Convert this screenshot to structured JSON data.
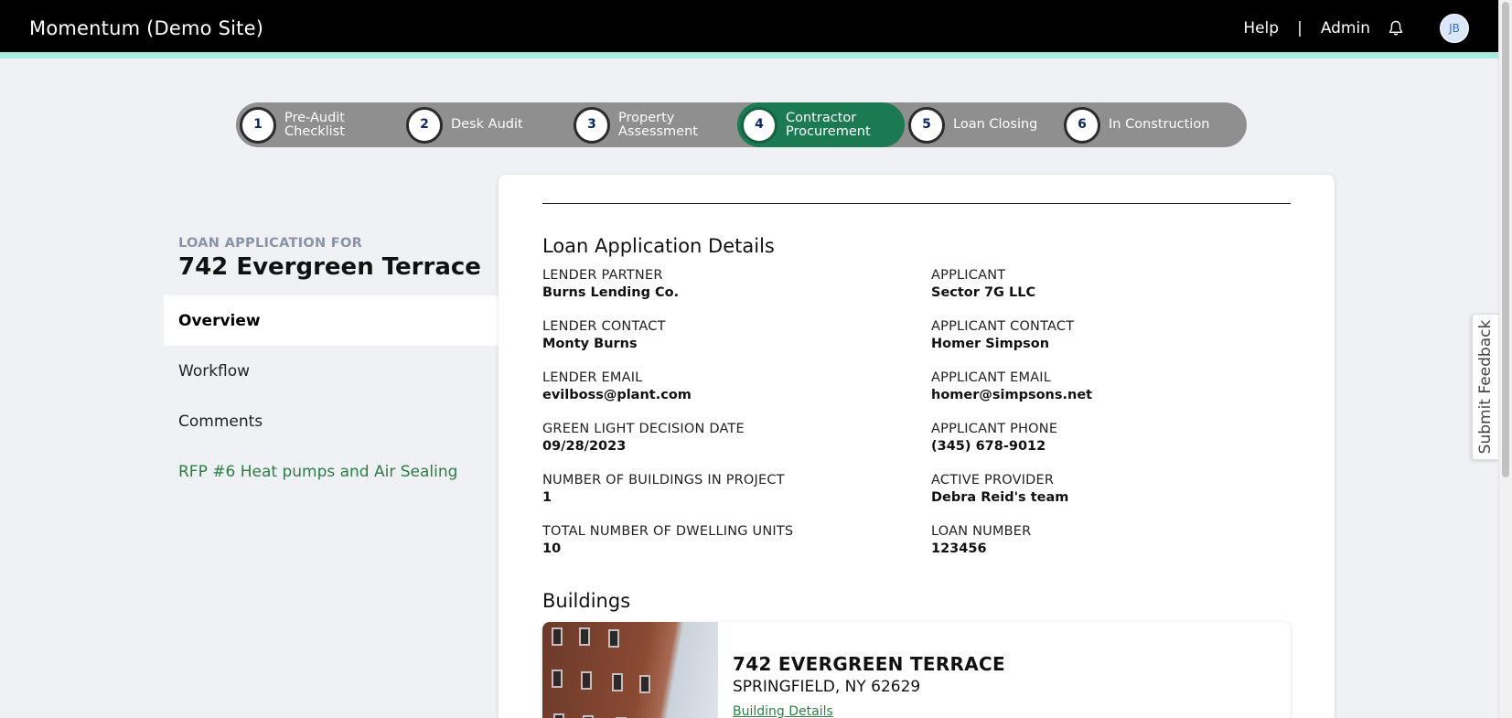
{
  "header": {
    "app_title": "Momentum (Demo Site)",
    "help": "Help",
    "separator": "|",
    "admin": "Admin",
    "avatar_initials": "JB"
  },
  "stepper": [
    {
      "num": "1",
      "label": "Pre-Audit Checklist",
      "active": false
    },
    {
      "num": "2",
      "label": "Desk Audit",
      "active": false
    },
    {
      "num": "3",
      "label": "Property Assessment",
      "active": false
    },
    {
      "num": "4",
      "label": "Contractor Procurement",
      "active": true
    },
    {
      "num": "5",
      "label": "Loan Closing",
      "active": false
    },
    {
      "num": "6",
      "label": "In Construction",
      "active": false
    }
  ],
  "sidebar": {
    "heading_small": "LOAN APPLICATION FOR",
    "heading": "742 Evergreen Terrace",
    "items": [
      {
        "label": "Overview"
      },
      {
        "label": "Workflow"
      },
      {
        "label": "Comments"
      },
      {
        "label": "RFP #6 Heat pumps and Air Sealing"
      }
    ]
  },
  "details": {
    "title": "Loan Application Details",
    "left": [
      {
        "label": "LENDER PARTNER",
        "value": "Burns Lending Co."
      },
      {
        "label": "LENDER CONTACT",
        "value": "Monty Burns"
      },
      {
        "label": "LENDER EMAIL",
        "value": "evilboss@plant.com"
      },
      {
        "label": "GREEN LIGHT DECISION DATE",
        "value": "09/28/2023"
      },
      {
        "label": "NUMBER OF BUILDINGS IN PROJECT",
        "value": "1"
      },
      {
        "label": "TOTAL NUMBER OF DWELLING UNITS",
        "value": "10"
      }
    ],
    "right": [
      {
        "label": "APPLICANT",
        "value": "Sector 7G LLC"
      },
      {
        "label": "APPLICANT CONTACT",
        "value": "Homer Simpson"
      },
      {
        "label": "APPLICANT EMAIL",
        "value": "homer@simpsons.net"
      },
      {
        "label": "APPLICANT PHONE",
        "value": "(345) 678-9012"
      },
      {
        "label": "ACTIVE PROVIDER",
        "value": "Debra Reid's team"
      },
      {
        "label": "LOAN NUMBER",
        "value": "123456"
      }
    ]
  },
  "buildings": {
    "title": "Buildings",
    "items": [
      {
        "name": "742 EVERGREEN TERRACE",
        "city": "SPRINGFIELD, NY 62629",
        "link": "Building Details"
      }
    ]
  },
  "feedback": "Submit Feedback",
  "colors": {
    "accent": "#1b7a52",
    "topbar": "#000000",
    "topbar_border": "#a8ece0",
    "link_green": "#2e7d46"
  }
}
